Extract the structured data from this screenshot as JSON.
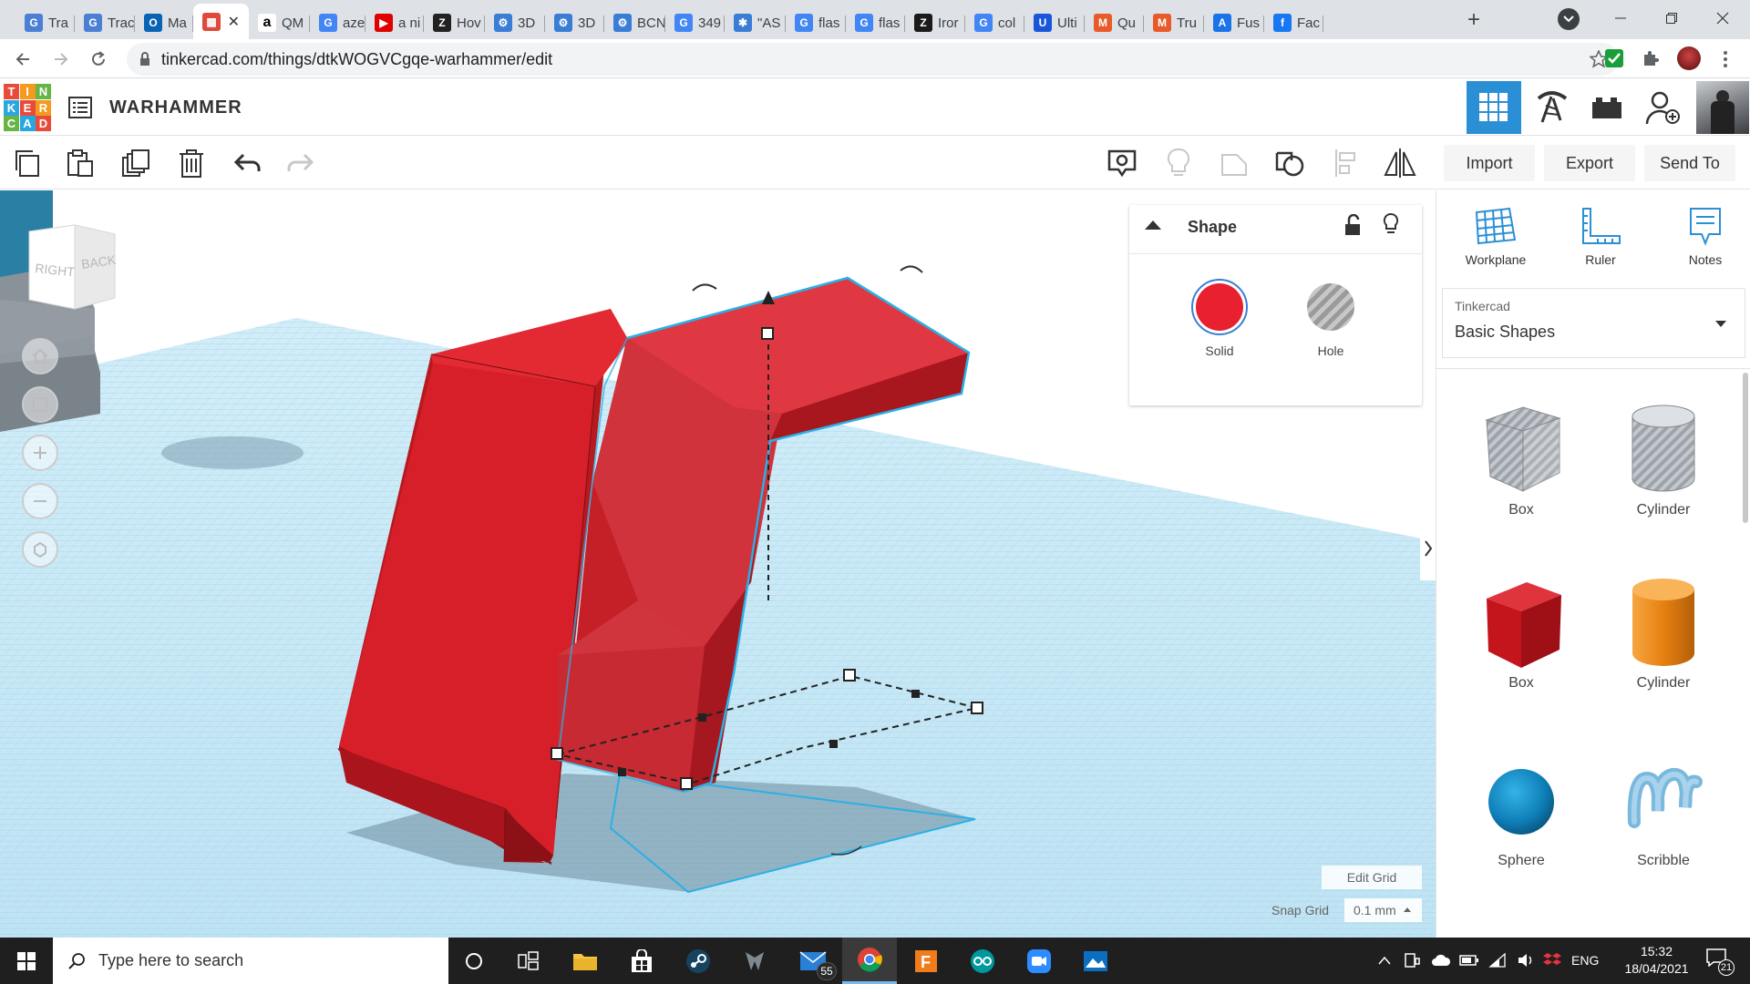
{
  "browser": {
    "tabs": [
      {
        "title": "Tra",
        "color": "#4a7fd4",
        "glyph": "G"
      },
      {
        "title": "Trac",
        "color": "#4a7fd4",
        "glyph": "G"
      },
      {
        "title": "Ma",
        "color": "#0a64b4",
        "glyph": "O"
      },
      {
        "title": "",
        "color": "#e04a3a",
        "glyph": "▦"
      },
      {
        "title": "QM",
        "color": "#000000",
        "glyph": "a"
      },
      {
        "title": "aze",
        "color": "#4285f4",
        "glyph": "G"
      },
      {
        "title": "a ni",
        "color": "#e00000",
        "glyph": "▶"
      },
      {
        "title": "Hov",
        "color": "#222222",
        "glyph": "Z"
      },
      {
        "title": "3D",
        "color": "#3a7dd4",
        "glyph": "⚙"
      },
      {
        "title": "3D",
        "color": "#3a7dd4",
        "glyph": "⚙"
      },
      {
        "title": "BCN",
        "color": "#3a7dd4",
        "glyph": "⚙"
      },
      {
        "title": "349",
        "color": "#4285f4",
        "glyph": "G"
      },
      {
        "title": "\"AS",
        "color": "#3a7dd4",
        "glyph": "✱"
      },
      {
        "title": "flas",
        "color": "#4285f4",
        "glyph": "G"
      },
      {
        "title": "flas",
        "color": "#4285f4",
        "glyph": "G"
      },
      {
        "title": "Iror",
        "color": "#1a1a1a",
        "glyph": "Z"
      },
      {
        "title": "col",
        "color": "#4285f4",
        "glyph": "G"
      },
      {
        "title": "Ulti",
        "color": "#1a56db",
        "glyph": "U"
      },
      {
        "title": "Qu",
        "color": "#e85a2a",
        "glyph": "M"
      },
      {
        "title": "Tru",
        "color": "#e85a2a",
        "glyph": "M"
      },
      {
        "title": "Fus",
        "color": "#1a73e8",
        "glyph": "A"
      },
      {
        "title": "Fac",
        "color": "#1877f2",
        "glyph": "f"
      }
    ],
    "active_tab_close": "✕",
    "new_tab": "+",
    "url": "tinkercad.com/things/dtkWOGVCgqe-warhammer/edit"
  },
  "app": {
    "logo_rows": [
      "TIN",
      "KER",
      "CAD"
    ],
    "logo_colors": [
      "#e84b3a",
      "#f39a1f",
      "#66b545",
      "#2ba7df",
      "#e84b3a",
      "#f39a1f",
      "#66b545",
      "#2ba7df",
      "#e84b3a"
    ],
    "design_title": "WARHAMMER"
  },
  "toolbar": {
    "import": "Import",
    "export": "Export",
    "send_to": "Send To"
  },
  "viewcube": {
    "right": "RIGHT",
    "back": "BACK"
  },
  "inspector": {
    "title": "Shape",
    "solid": "Solid",
    "hole": "Hole",
    "solid_color": "#e8202f"
  },
  "sidebar": {
    "workplane": "Workplane",
    "ruler": "Ruler",
    "notes": "Notes",
    "library_caption": "Tinkercad",
    "library_value": "Basic Shapes",
    "shapes": [
      {
        "label": "Box"
      },
      {
        "label": "Cylinder"
      },
      {
        "label": "Box"
      },
      {
        "label": "Cylinder"
      },
      {
        "label": "Sphere"
      },
      {
        "label": "Scribble"
      }
    ]
  },
  "grid": {
    "edit_grid": "Edit Grid",
    "snap_label": "Snap Grid",
    "snap_value": "0.1 mm"
  },
  "taskbar": {
    "search_placeholder": "Type here to search",
    "mail_badge": "55",
    "language": "ENG",
    "time": "15:32",
    "date": "18/04/2021",
    "notif_count": "21"
  }
}
